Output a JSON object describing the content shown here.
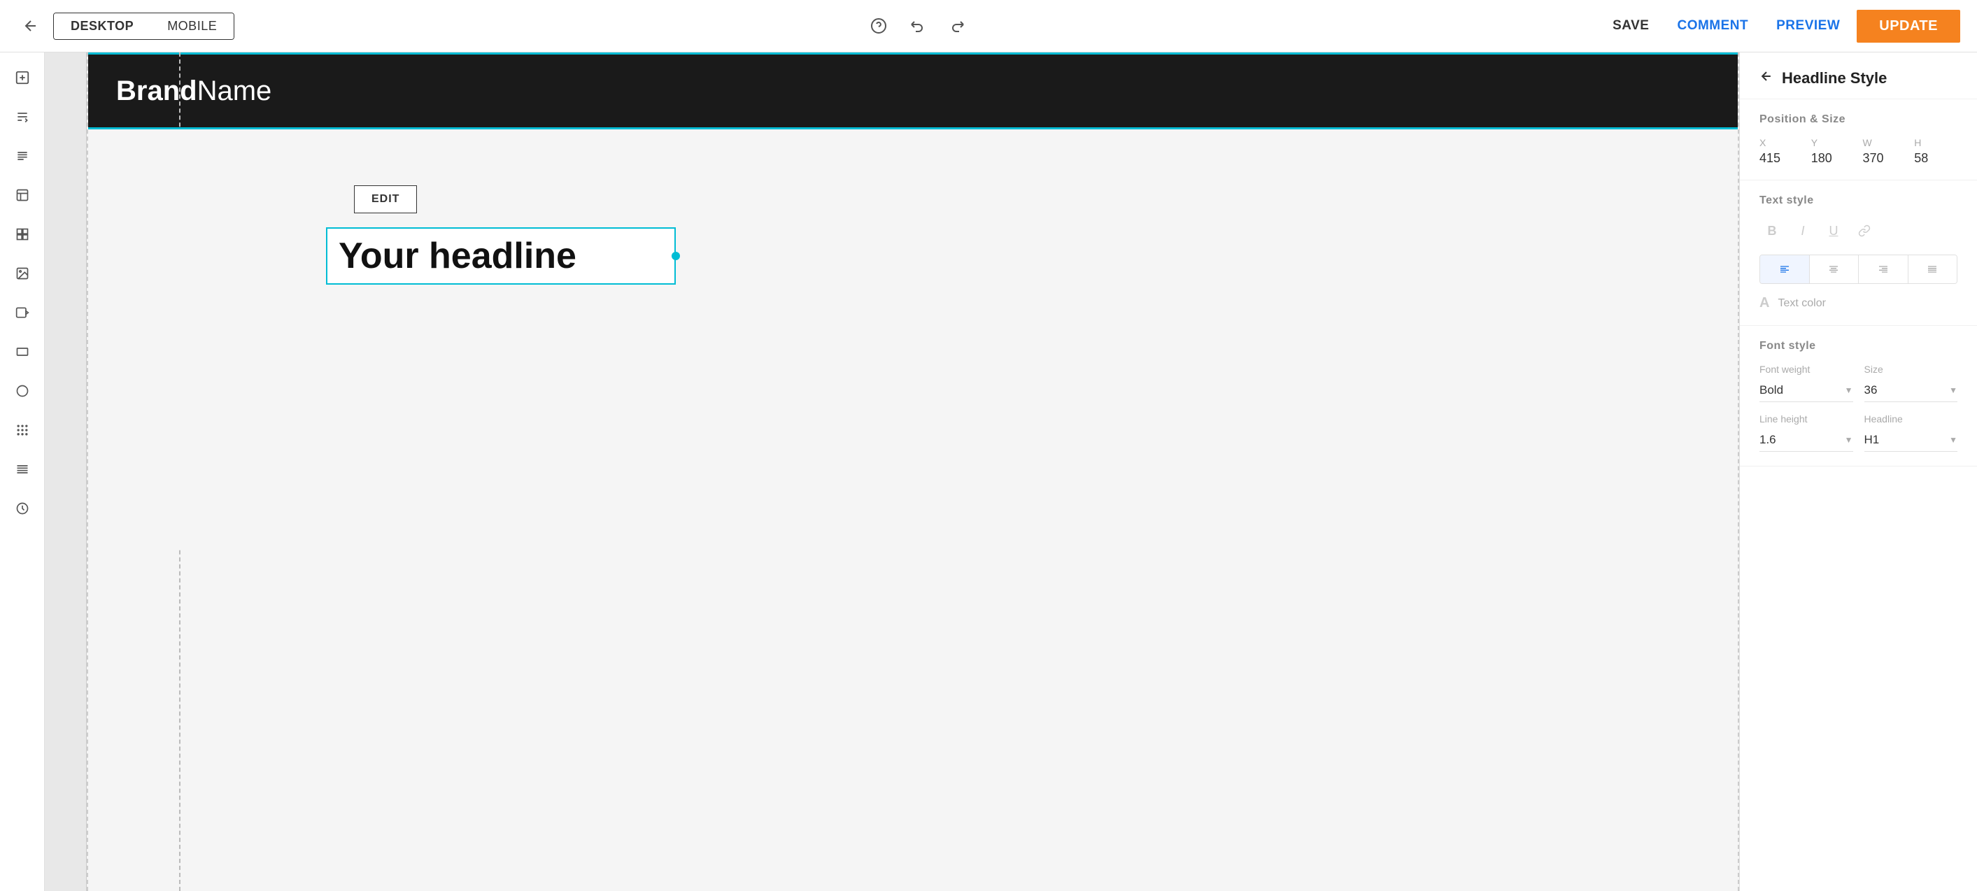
{
  "topbar": {
    "device_buttons": [
      {
        "label": "DESKTOP",
        "active": true
      },
      {
        "label": "MOBILE",
        "active": false
      }
    ],
    "save_label": "SAVE",
    "comment_label": "COMMENT",
    "preview_label": "PREVIEW",
    "update_label": "UPDATE",
    "back_icon": "←",
    "undo_icon": "↩",
    "redo_icon": "↪",
    "help_icon": "?"
  },
  "sidebar": {
    "icons": [
      {
        "name": "add-section-icon",
        "symbol": "+",
        "label": "Add"
      },
      {
        "name": "text-icon",
        "symbol": "T",
        "label": "Text"
      },
      {
        "name": "paragraph-icon",
        "symbol": "≡",
        "label": "Paragraph"
      },
      {
        "name": "layout-icon",
        "symbol": "☰",
        "label": "Layout"
      },
      {
        "name": "widget-icon",
        "symbol": "⊞",
        "label": "Widget"
      },
      {
        "name": "media-icon",
        "symbol": "⊟",
        "label": "Media"
      },
      {
        "name": "video-icon",
        "symbol": "▶",
        "label": "Video"
      },
      {
        "name": "shape-rect-icon",
        "symbol": "□",
        "label": "Rectangle"
      },
      {
        "name": "shape-circle-icon",
        "symbol": "○",
        "label": "Circle"
      },
      {
        "name": "dots-icon",
        "symbol": "⋮⋮",
        "label": "Grid"
      },
      {
        "name": "lines-icon",
        "symbol": "≣",
        "label": "Lines"
      },
      {
        "name": "clock-icon",
        "symbol": "⏰",
        "label": "History"
      }
    ]
  },
  "canvas": {
    "site_header": {
      "brand_bold": "Brand",
      "brand_normal": "Name"
    },
    "edit_button_label": "EDIT",
    "headline_text": "Your headline"
  },
  "right_panel": {
    "back_icon": "←",
    "title": "Headline Style",
    "position_size": {
      "section_label": "Position & Size",
      "fields": [
        {
          "label": "X",
          "value": "415"
        },
        {
          "label": "Y",
          "value": "180"
        },
        {
          "label": "W",
          "value": "370"
        },
        {
          "label": "H",
          "value": "58"
        }
      ]
    },
    "text_style": {
      "section_label": "Text style",
      "format_icons": [
        {
          "name": "bold-icon",
          "symbol": "B"
        },
        {
          "name": "italic-icon",
          "symbol": "I"
        },
        {
          "name": "underline-icon",
          "symbol": "U"
        },
        {
          "name": "link-icon",
          "symbol": "🔗"
        }
      ],
      "align_icons": [
        {
          "name": "align-left-icon",
          "symbol": "≡",
          "active": true
        },
        {
          "name": "align-center-icon",
          "symbol": "≡",
          "active": false
        },
        {
          "name": "align-right-icon",
          "symbol": "≡",
          "active": false
        },
        {
          "name": "align-justify-icon",
          "symbol": "≡",
          "active": false
        }
      ],
      "text_color_icon": "A",
      "text_color_label": "Text color"
    },
    "font_style": {
      "section_label": "Font style",
      "font_weight_label": "Font weight",
      "font_weight_value": "Bold",
      "size_label": "Size",
      "size_value": "36",
      "line_height_label": "Line height",
      "line_height_value": "1.6",
      "headline_label": "Headline",
      "headline_value": "H1"
    }
  }
}
